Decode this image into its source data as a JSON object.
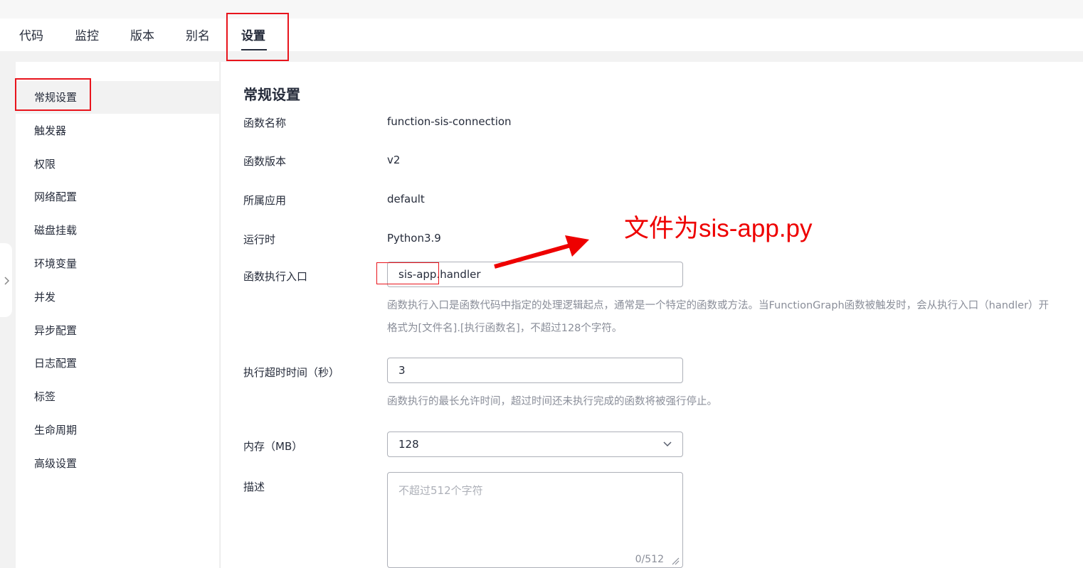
{
  "tabs": [
    {
      "label": "代码"
    },
    {
      "label": "监控"
    },
    {
      "label": "版本"
    },
    {
      "label": "别名"
    },
    {
      "label": "设置",
      "active": true
    }
  ],
  "sidebar": {
    "items": [
      {
        "label": "常规设置",
        "active": true
      },
      {
        "label": "触发器"
      },
      {
        "label": "权限"
      },
      {
        "label": "网络配置"
      },
      {
        "label": "磁盘挂载"
      },
      {
        "label": "环境变量"
      },
      {
        "label": "并发"
      },
      {
        "label": "异步配置"
      },
      {
        "label": "日志配置"
      },
      {
        "label": "标签"
      },
      {
        "label": "生命周期"
      },
      {
        "label": "高级设置"
      }
    ],
    "collapse_icon": "chevron-right-icon"
  },
  "main": {
    "title": "常规设置",
    "function_name": {
      "label": "函数名称",
      "value": "function-sis-connection"
    },
    "function_version": {
      "label": "函数版本",
      "value": "v2"
    },
    "application": {
      "label": "所属应用",
      "value": "default"
    },
    "runtime": {
      "label": "运行时",
      "value": "Python3.9"
    },
    "handler": {
      "label": "函数执行入口",
      "value": "sis-app.handler",
      "help_line1": "函数执行入口是函数代码中指定的处理逻辑起点，通常是一个特定的函数或方法。当FunctionGraph函数被触发时，会从执行入口（handler）开",
      "help_line2": "格式为[文件名].[执行函数名]，不超过128个字符。"
    },
    "timeout": {
      "label": "执行超时时间（秒）",
      "value": "3",
      "help": "函数执行的最长允许时间，超过时间还未执行完成的函数将被强行停止。"
    },
    "memory": {
      "label": "内存（MB）",
      "value": "128",
      "icon": "chevron-down-icon"
    },
    "description": {
      "label": "描述",
      "placeholder": "不超过512个字符",
      "counter": "0/512"
    }
  },
  "annotation": {
    "text": "文件为sis-app.py",
    "color": "#ee0000"
  },
  "colors": {
    "highlight_border": "#e8141c",
    "text_primary": "#252b3a",
    "text_secondary": "#8a8e99"
  }
}
